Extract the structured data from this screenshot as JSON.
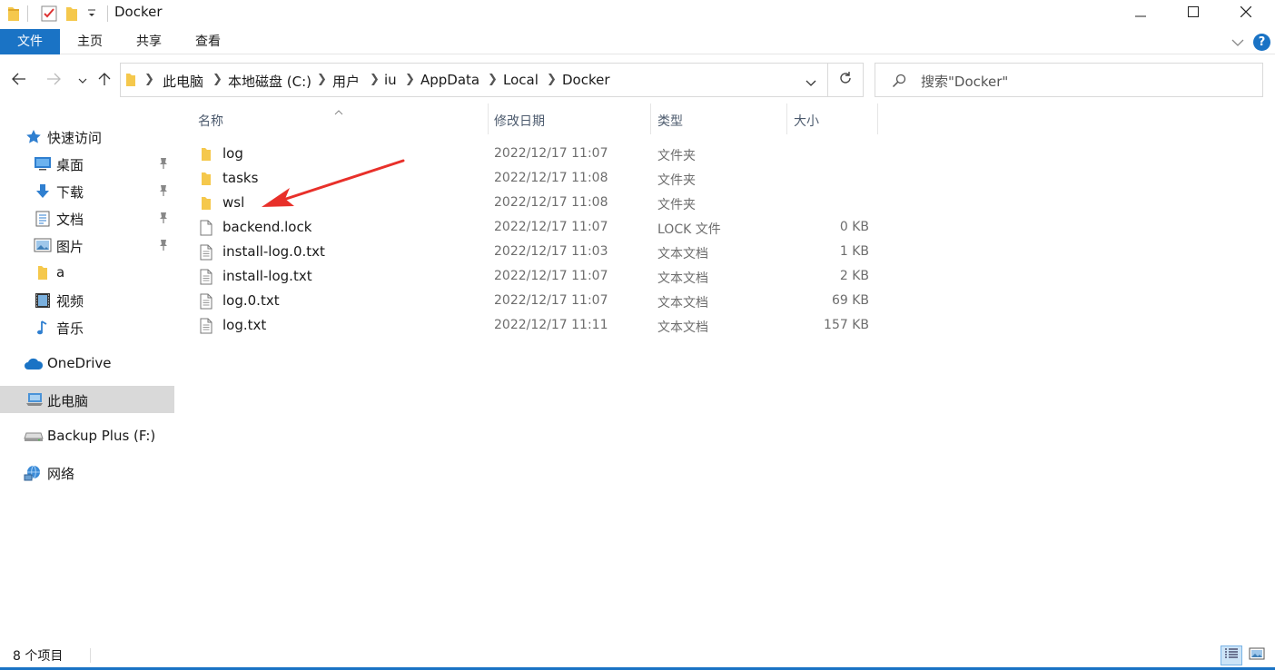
{
  "window": {
    "title": "Docker"
  },
  "ribbon": {
    "tabs": [
      {
        "label": "文件"
      },
      {
        "label": "主页"
      },
      {
        "label": "共享"
      },
      {
        "label": "查看"
      }
    ],
    "help_label": "?"
  },
  "address": {
    "crumbs": [
      "此电脑",
      "本地磁盘 (C:)",
      "用户",
      "iu",
      "AppData",
      "Local",
      "Docker"
    ]
  },
  "search": {
    "placeholder": "搜索\"Docker\""
  },
  "sidebar": {
    "items": [
      {
        "label": "快速访问",
        "icon": "star-icon"
      },
      {
        "label": "桌面",
        "icon": "desktop-icon"
      },
      {
        "label": "下载",
        "icon": "download-arrow-icon"
      },
      {
        "label": "文档",
        "icon": "document-icon"
      },
      {
        "label": "图片",
        "icon": "pictures-icon"
      },
      {
        "label": "a",
        "icon": "folder-icon"
      },
      {
        "label": "视频",
        "icon": "video-icon"
      },
      {
        "label": "音乐",
        "icon": "music-note-icon"
      },
      {
        "label": "OneDrive",
        "icon": "cloud-icon"
      },
      {
        "label": "此电脑",
        "icon": "computer-icon"
      },
      {
        "label": "Backup Plus (F:)",
        "icon": "drive-icon"
      },
      {
        "label": "网络",
        "icon": "network-icon"
      }
    ],
    "selected": "此电脑"
  },
  "columns": {
    "name": "名称",
    "date": "修改日期",
    "type": "类型",
    "size": "大小"
  },
  "files": [
    {
      "name": "log",
      "date": "2022/12/17 11:07",
      "type": "文件夹",
      "size": "",
      "icon": "folder-icon"
    },
    {
      "name": "tasks",
      "date": "2022/12/17 11:08",
      "type": "文件夹",
      "size": "",
      "icon": "folder-icon"
    },
    {
      "name": "wsl",
      "date": "2022/12/17 11:08",
      "type": "文件夹",
      "size": "",
      "icon": "folder-icon"
    },
    {
      "name": "backend.lock",
      "date": "2022/12/17 11:07",
      "type": "LOCK 文件",
      "size": "0 KB",
      "icon": "file-icon"
    },
    {
      "name": "install-log.0.txt",
      "date": "2022/12/17 11:03",
      "type": "文本文档",
      "size": "1 KB",
      "icon": "text-file-icon"
    },
    {
      "name": "install-log.txt",
      "date": "2022/12/17 11:07",
      "type": "文本文档",
      "size": "2 KB",
      "icon": "text-file-icon"
    },
    {
      "name": "log.0.txt",
      "date": "2022/12/17 11:07",
      "type": "文本文档",
      "size": "69 KB",
      "icon": "text-file-icon"
    },
    {
      "name": "log.txt",
      "date": "2022/12/17 11:11",
      "type": "文本文档",
      "size": "157 KB",
      "icon": "text-file-icon"
    }
  ],
  "status": {
    "item_count": "8 个项目"
  },
  "colors": {
    "accent": "#1a73c5",
    "folder": "#f5c84c",
    "annotation_arrow": "#e8302a"
  }
}
